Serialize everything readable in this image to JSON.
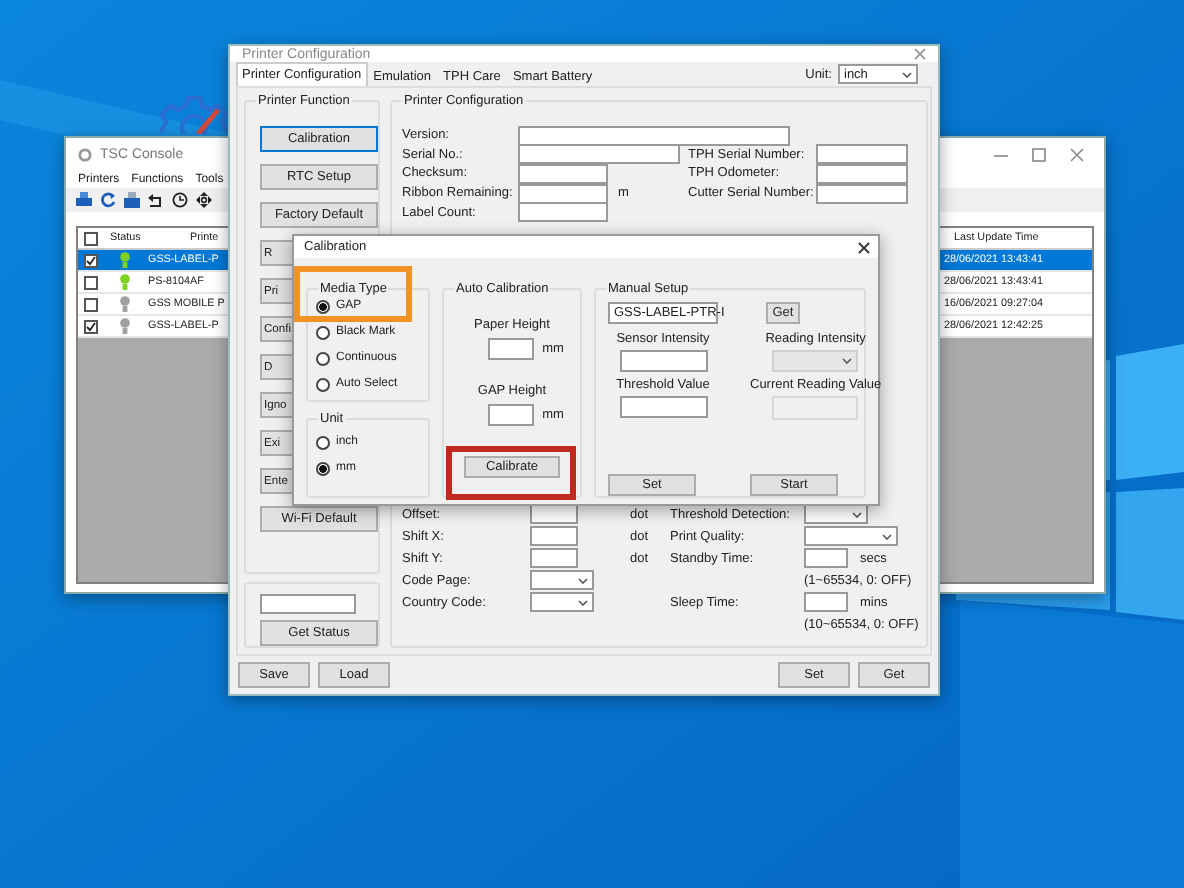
{
  "console": {
    "title": "TSC Console",
    "menu": [
      "Printers",
      "Functions",
      "Tools"
    ],
    "header_checked": false,
    "columns": [
      "Status",
      "Printe",
      "Last Update Time"
    ],
    "rows": [
      {
        "checked": true,
        "selected": true,
        "color": "#7ed321",
        "printer": "GSS-LABEL-P",
        "time": "28/06/2021 13:43:41"
      },
      {
        "checked": false,
        "selected": false,
        "color": "#7ed321",
        "printer": "PS-8104AF",
        "time": "28/06/2021 13:43:41"
      },
      {
        "checked": false,
        "selected": false,
        "color": "#a0a0a0",
        "printer": "GSS MOBILE P",
        "time": "16/06/2021 09:27:04"
      },
      {
        "checked": true,
        "selected": false,
        "color": "#a0a0a0",
        "printer": "GSS-LABEL-P",
        "time": "28/06/2021 12:42:25"
      }
    ]
  },
  "config": {
    "title": "Printer Configuration",
    "tabs": [
      {
        "label": "Printer Configuration",
        "selected": true
      },
      {
        "label": "Emulation",
        "selected": false
      },
      {
        "label": "TPH Care",
        "selected": false
      },
      {
        "label": "Smart Battery",
        "selected": false
      }
    ],
    "unit_label": "Unit:",
    "unit": "inch",
    "function_title": "Printer Function",
    "function_buttons": [
      {
        "label": "Calibration",
        "kind": "full",
        "focused": true
      },
      {
        "label": "RTC Setup",
        "kind": "full",
        "focused": false
      },
      {
        "label": "Factory Default",
        "kind": "full",
        "focused": false
      },
      {
        "label": "R",
        "kind": "cut",
        "focused": false
      },
      {
        "label": "Pri",
        "kind": "cut",
        "focused": false
      },
      {
        "label": "Confi",
        "kind": "cut",
        "focused": false
      },
      {
        "label": "D",
        "kind": "cut",
        "focused": false
      },
      {
        "label": "Igno",
        "kind": "cut",
        "focused": false
      },
      {
        "label": "Exi",
        "kind": "cut",
        "focused": false
      },
      {
        "label": "Ente",
        "kind": "cut",
        "focused": false
      },
      {
        "label": "Wi-Fi Default",
        "kind": "full",
        "focused": false
      }
    ],
    "get_status": "Get Status",
    "info_title": "Printer Configuration",
    "info_left": [
      {
        "label": "Version:",
        "kind": "long"
      },
      {
        "label": "Serial No.:",
        "kind": "medium"
      },
      {
        "label": "Checksum:",
        "kind": "short"
      },
      {
        "label": "Ribbon Remaining:",
        "kind": "short",
        "unit": "m"
      },
      {
        "label": "Label Count:",
        "kind": "short"
      }
    ],
    "info_right": [
      "TPH Serial Number:",
      "TPH Odometer:",
      "Cutter Serial Number:"
    ],
    "settings_left": [
      {
        "label": "Offset:",
        "kind": "field",
        "unit": "dot"
      },
      {
        "label": "Shift X:",
        "kind": "field",
        "unit": "dot"
      },
      {
        "label": "Shift Y:",
        "kind": "field",
        "unit": "dot"
      },
      {
        "label": "Code Page:",
        "kind": "dropdown"
      },
      {
        "label": "Country Code:",
        "kind": "dropdown"
      }
    ],
    "settings_right": [
      {
        "label": "Threshold Detection:",
        "kind": "dropdown"
      },
      {
        "label": "Print Quality:",
        "kind": "wide-dropdown"
      },
      {
        "label": "Standby Time:",
        "kind": "field",
        "unit": "secs",
        "hint": "(1~65534, 0: OFF)"
      },
      {
        "label": "Sleep Time:",
        "kind": "field",
        "unit": "mins",
        "hint": "(10~65534, 0: OFF)"
      }
    ],
    "footer_left": [
      "Save",
      "Load"
    ],
    "footer_right": [
      "Set",
      "Get"
    ]
  },
  "calibration": {
    "title": "Calibration",
    "media_title": "Media Type",
    "media": [
      {
        "label": "GAP",
        "selected": true
      },
      {
        "label": "Black Mark",
        "selected": false
      },
      {
        "label": "Continuous",
        "selected": false
      },
      {
        "label": "Auto Select",
        "selected": false
      }
    ],
    "unit_title": "Unit",
    "units": [
      {
        "label": "inch",
        "selected": false
      },
      {
        "label": "mm",
        "selected": true
      }
    ],
    "auto_title": "Auto Calibration",
    "heights": [
      {
        "label": "Paper Height",
        "unit": "mm"
      },
      {
        "label": "GAP Height",
        "unit": "mm"
      }
    ],
    "calibrate": "Calibrate",
    "manual_title": "Manual Setup",
    "printer": "GSS-LABEL-PTR-I",
    "get": "Get",
    "sensor": "Sensor Intensity",
    "reading": {
      "label": "Reading Intensity",
      "disabled": true
    },
    "threshold": "Threshold Value",
    "current": "Current Reading Value",
    "set": "Set",
    "start": "Start"
  },
  "annotations": [
    {
      "color": "#f39224"
    },
    {
      "color": "#c0291f"
    }
  ]
}
